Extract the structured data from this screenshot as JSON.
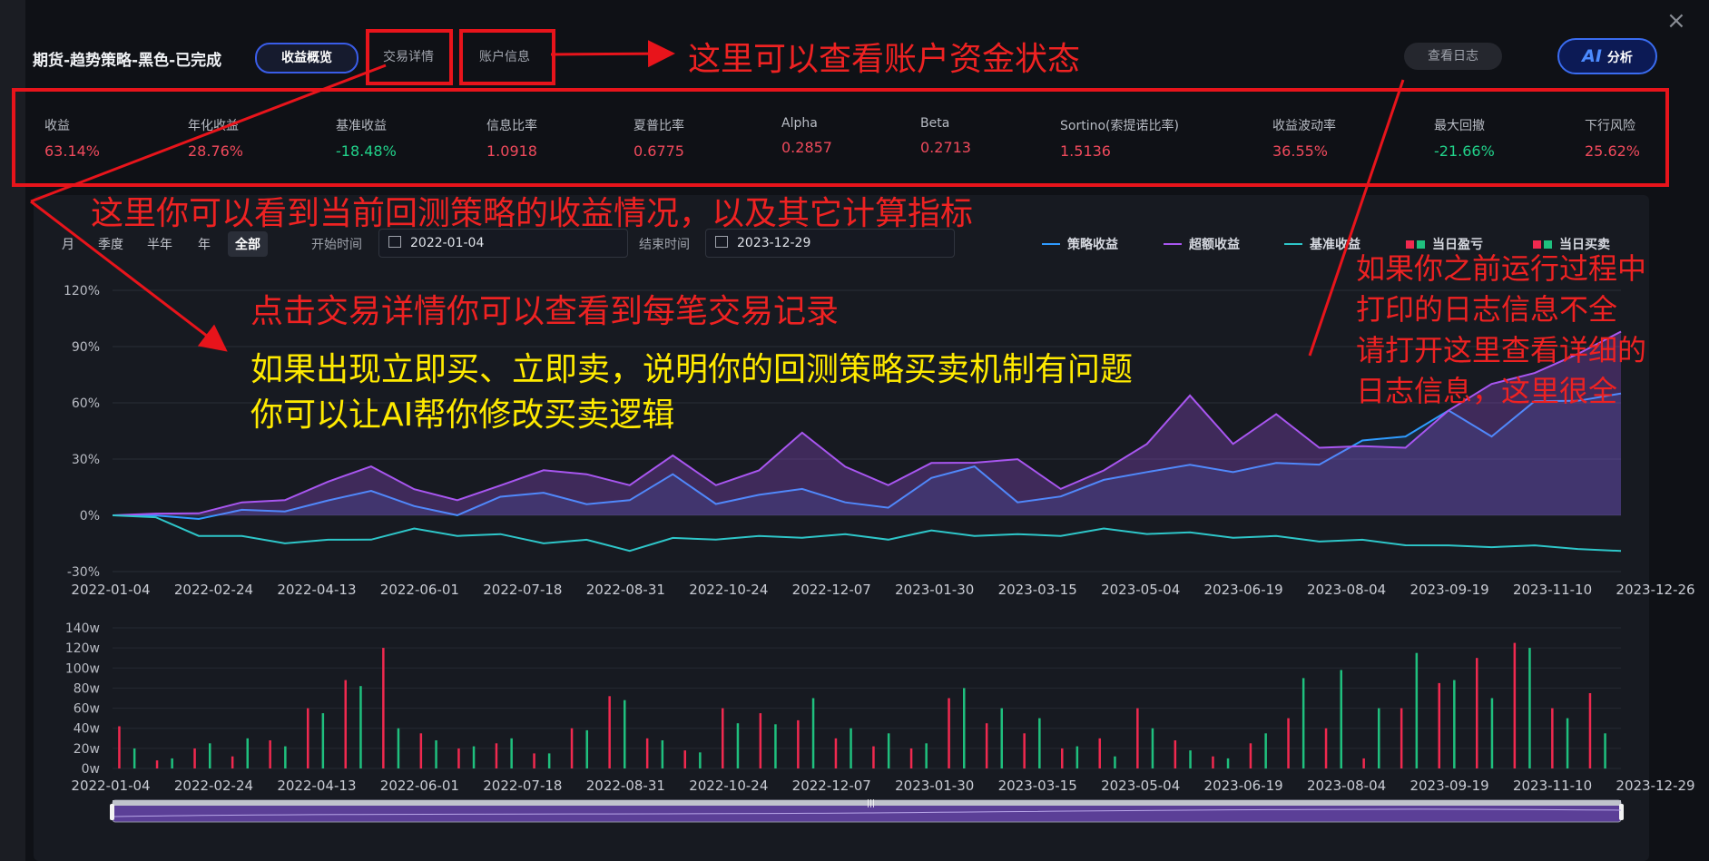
{
  "header": {
    "title": "期货-趋势策略-黑色-已完成",
    "tabs": [
      "收益概览",
      "交易详情",
      "账户信息"
    ],
    "log_button": "查看日志",
    "ai_button_mark": "AI",
    "ai_button_label": "分析",
    "close": "×"
  },
  "metrics": [
    {
      "label": "收益",
      "value": "63.14%",
      "color": "#f04a5c"
    },
    {
      "label": "年化收益",
      "value": "28.76%",
      "color": "#f04a5c"
    },
    {
      "label": "基准收益",
      "value": "-18.48%",
      "color": "#21d28a"
    },
    {
      "label": "信息比率",
      "value": "1.0918",
      "color": "#f04a5c"
    },
    {
      "label": "夏普比率",
      "value": "0.6775",
      "color": "#f04a5c"
    },
    {
      "label": "Alpha",
      "value": "0.2857",
      "color": "#f04a5c"
    },
    {
      "label": "Beta",
      "value": "0.2713",
      "color": "#f04a5c"
    },
    {
      "label": "Sortino(索提诺比率)",
      "value": "1.5136",
      "color": "#f04a5c"
    },
    {
      "label": "收益波动率",
      "value": "36.55%",
      "color": "#f04a5c"
    },
    {
      "label": "最大回撤",
      "value": "-21.66%",
      "color": "#21d28a"
    },
    {
      "label": "下行风险",
      "value": "25.62%",
      "color": "#f04a5c"
    }
  ],
  "controls": {
    "periods": [
      "月",
      "季度",
      "半年",
      "年",
      "全部"
    ],
    "active_period": "全部",
    "start_label": "开始时间",
    "start_value": "2022-01-04",
    "end_label": "结束时间",
    "end_value": "2023-12-29"
  },
  "legend": [
    {
      "name": "策略收益",
      "kind": "line",
      "color": "#2f9bff"
    },
    {
      "name": "超额收益",
      "kind": "line",
      "color": "#a856f0"
    },
    {
      "name": "基准收益",
      "kind": "line",
      "color": "#2ec6c9"
    },
    {
      "name": "当日盈亏",
      "kind": "squares",
      "colors": [
        "#f0294f",
        "#1fc07e"
      ]
    },
    {
      "name": "当日买卖",
      "kind": "squares",
      "colors": [
        "#f0294f",
        "#1fc07e"
      ]
    }
  ],
  "annotations": {
    "account": "这里可以查看账户资金状态",
    "metrics": "这里你可以看到当前回测策略的收益情况，以及其它计算指标",
    "trades": "点击交易详情你可以查看到每笔交易记录",
    "warn_line1": "如果出现立即买、立即卖，说明你的回测策略买卖机制有问题",
    "warn_line2": "你可以让AI帮你修改买卖逻辑",
    "log_line1": "如果你之前运行过程中",
    "log_line2": "打印的日志信息不全",
    "log_line3": "请打开这里查看详细的",
    "log_line4": "日志信息，这里很全"
  },
  "chart_data": [
    {
      "type": "line",
      "title": "",
      "x_ticks": [
        "2022-01-04",
        "2022-02-24",
        "2022-04-13",
        "2022-06-01",
        "2022-07-18",
        "2022-08-31",
        "2022-10-24",
        "2022-12-07",
        "2023-01-30",
        "2023-03-15",
        "2023-05-04",
        "2023-06-19",
        "2023-08-04",
        "2023-09-19",
        "2023-11-10",
        "2023-12-26"
      ],
      "y_ticks": [
        "120%",
        "90%",
        "60%",
        "30%",
        "0%",
        "-30%"
      ],
      "ylim": [
        -30,
        120
      ],
      "unit": "%",
      "series": [
        {
          "name": "策略收益",
          "color": "#2f9bff",
          "values": [
            0,
            -2,
            0,
            1,
            4,
            6,
            15,
            3,
            2,
            8,
            14,
            4,
            10,
            20,
            8,
            9,
            16,
            5,
            6,
            18,
            28,
            5,
            12,
            17,
            25,
            25,
            25,
            26,
            29,
            38,
            44,
            54,
            44,
            59,
            63,
            65
          ]
        },
        {
          "name": "超额收益",
          "color": "#a856f0",
          "values": [
            0,
            -1,
            3,
            5,
            10,
            16,
            28,
            12,
            10,
            14,
            26,
            20,
            18,
            30,
            18,
            22,
            46,
            24,
            18,
            26,
            30,
            28,
            16,
            22,
            40,
            62,
            40,
            52,
            38,
            35,
            38,
            54,
            72,
            74,
            88,
            98
          ]
        },
        {
          "name": "基准收益",
          "color": "#2ec6c9",
          "values": [
            0,
            -2,
            -10,
            -12,
            -14,
            -14,
            -12,
            -8,
            -10,
            -11,
            -14,
            -14,
            -18,
            -13,
            -12,
            -12,
            -11,
            -11,
            -12,
            -9,
            -10,
            -11,
            -10,
            -8,
            -9,
            -10,
            -11,
            -12,
            -13,
            -14,
            -15,
            -17,
            -16,
            -17,
            -17,
            -19
          ]
        }
      ]
    },
    {
      "type": "bar",
      "title": "",
      "y_ticks": [
        "140w",
        "120w",
        "100w",
        "80w",
        "60w",
        "40w",
        "20w",
        "0w"
      ],
      "ylim": [
        0,
        140
      ],
      "unit": "w",
      "x_ticks": [
        "2022-01-04",
        "2022-02-24",
        "2022-04-13",
        "2022-06-01",
        "2022-07-18",
        "2022-08-31",
        "2022-10-24",
        "2022-12-07",
        "2023-01-30",
        "2023-03-15",
        "2023-05-04",
        "2023-06-19",
        "2023-08-04",
        "2023-09-19",
        "2023-11-10",
        "2023-12-29"
      ],
      "series": [
        {
          "name": "当日盈亏",
          "color": "#f0294f",
          "values": [
            42,
            8,
            20,
            12,
            28,
            60,
            88,
            120,
            35,
            20,
            25,
            15,
            40,
            72,
            30,
            18,
            60,
            55,
            48,
            30,
            22,
            20,
            70,
            45,
            35,
            20,
            30,
            60,
            28,
            12,
            25,
            50,
            40,
            10,
            60,
            85,
            110,
            125,
            60,
            75
          ]
        },
        {
          "name": "当日买卖",
          "color": "#1fc07e",
          "values": [
            20,
            10,
            25,
            30,
            22,
            55,
            82,
            40,
            28,
            22,
            30,
            15,
            38,
            68,
            28,
            16,
            45,
            44,
            70,
            40,
            35,
            25,
            80,
            60,
            50,
            22,
            12,
            40,
            18,
            10,
            35,
            90,
            98,
            60,
            115,
            88,
            70,
            120,
            50,
            35
          ]
        }
      ]
    }
  ]
}
